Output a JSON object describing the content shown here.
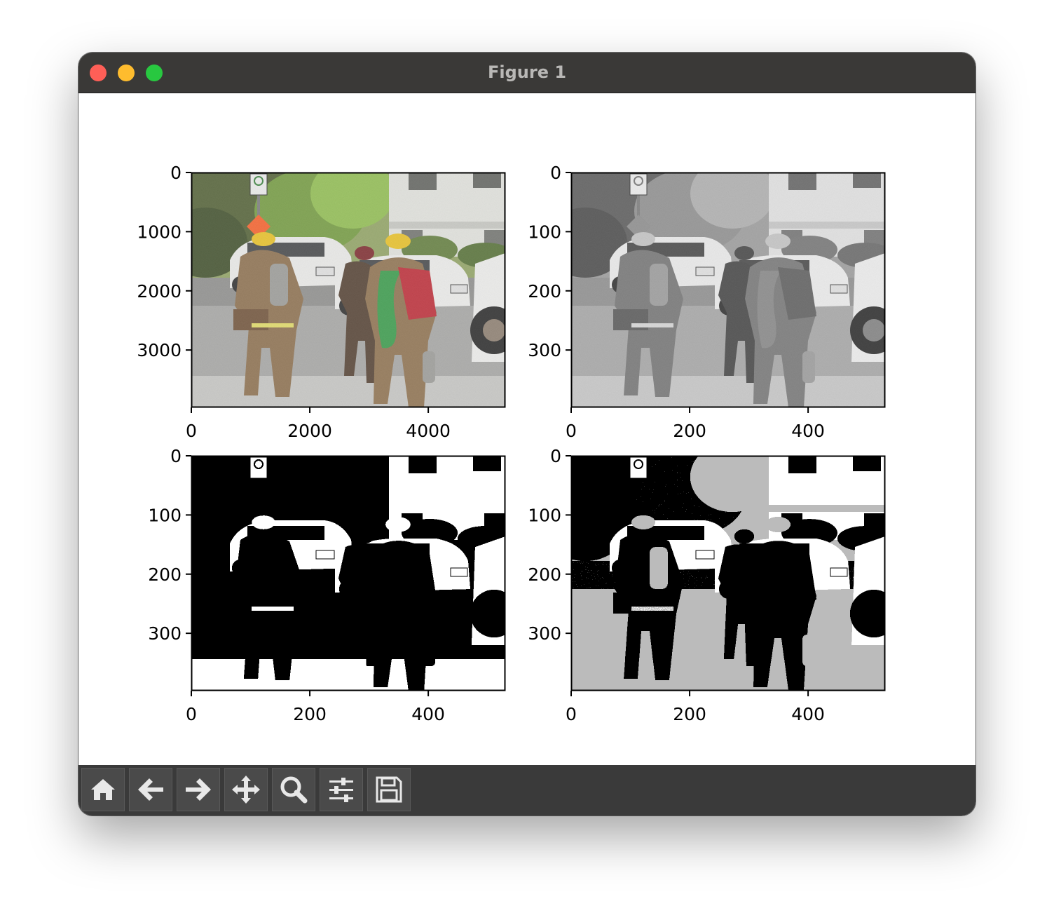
{
  "window": {
    "title": "Figure 1"
  },
  "toolbar": {
    "buttons": [
      {
        "name": "home-button",
        "icon": "home-icon"
      },
      {
        "name": "back-button",
        "icon": "arrow-left-icon"
      },
      {
        "name": "forward-button",
        "icon": "arrow-right-icon"
      },
      {
        "name": "pan-button",
        "icon": "move-icon"
      },
      {
        "name": "zoom-button",
        "icon": "magnifier-icon"
      },
      {
        "name": "configure-subplots-button",
        "icon": "sliders-icon"
      },
      {
        "name": "save-button",
        "icon": "floppy-disk-icon"
      }
    ]
  },
  "chart_data": [
    {
      "type": "image",
      "description_label": "original color photo",
      "xticks": [
        "0",
        "2000",
        "4000"
      ],
      "yticks": [
        "0",
        "1000",
        "2000",
        "3000"
      ],
      "xlim": [
        0,
        5300
      ],
      "ylim": [
        3970,
        0
      ]
    },
    {
      "type": "image",
      "description_label": "grayscale",
      "xticks": [
        "0",
        "200",
        "400"
      ],
      "yticks": [
        "0",
        "100",
        "200",
        "300"
      ],
      "xlim": [
        0,
        530
      ],
      "ylim": [
        397,
        0
      ]
    },
    {
      "type": "image",
      "description_label": "two-tone",
      "xticks": [
        "0",
        "200",
        "400"
      ],
      "yticks": [
        "0",
        "100",
        "200",
        "300"
      ],
      "xlim": [
        0,
        530
      ],
      "ylim": [
        397,
        0
      ]
    },
    {
      "type": "image",
      "description_label": "three-tone",
      "xticks": [
        "0",
        "200",
        "400"
      ],
      "yticks": [
        "0",
        "100",
        "200",
        "300"
      ],
      "xlim": [
        0,
        530
      ],
      "ylim": [
        397,
        0
      ]
    }
  ]
}
